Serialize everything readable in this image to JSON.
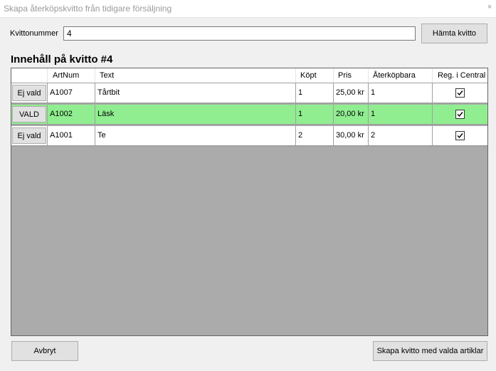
{
  "window": {
    "title": "Skapa återköpskvitto från tidigare försäljning",
    "close_glyph": "×"
  },
  "form": {
    "kvitto_label": "Kvittonummer",
    "kvitto_value": "4",
    "fetch_button": "Hämta kvitto"
  },
  "receipt": {
    "heading": "Innehåll på kvitto #4",
    "columns": [
      "",
      "ArtNum",
      "Text",
      "Köpt",
      "Pris",
      "Återköpbara",
      "Reg. i Central"
    ],
    "rows": [
      {
        "select": "Ej vald",
        "artnum": "A1007",
        "text": "Tårtbit",
        "kopt": "1",
        "pris": "25,00 kr",
        "aterkopbara": "1",
        "reg_central": true,
        "selected": false
      },
      {
        "select": "VALD",
        "artnum": "A1002",
        "text": "Läsk",
        "kopt": "1",
        "pris": "20,00 kr",
        "aterkopbara": "1",
        "reg_central": true,
        "selected": true
      },
      {
        "select": "Ej vald",
        "artnum": "A1001",
        "text": "Te",
        "kopt": "2",
        "pris": "30,00 kr",
        "aterkopbara": "2",
        "reg_central": true,
        "selected": false
      }
    ],
    "selected_row_color": "#90ee90"
  },
  "footer": {
    "cancel_button": "Avbryt",
    "create_button": "Skapa kvitto med valda artiklar"
  }
}
